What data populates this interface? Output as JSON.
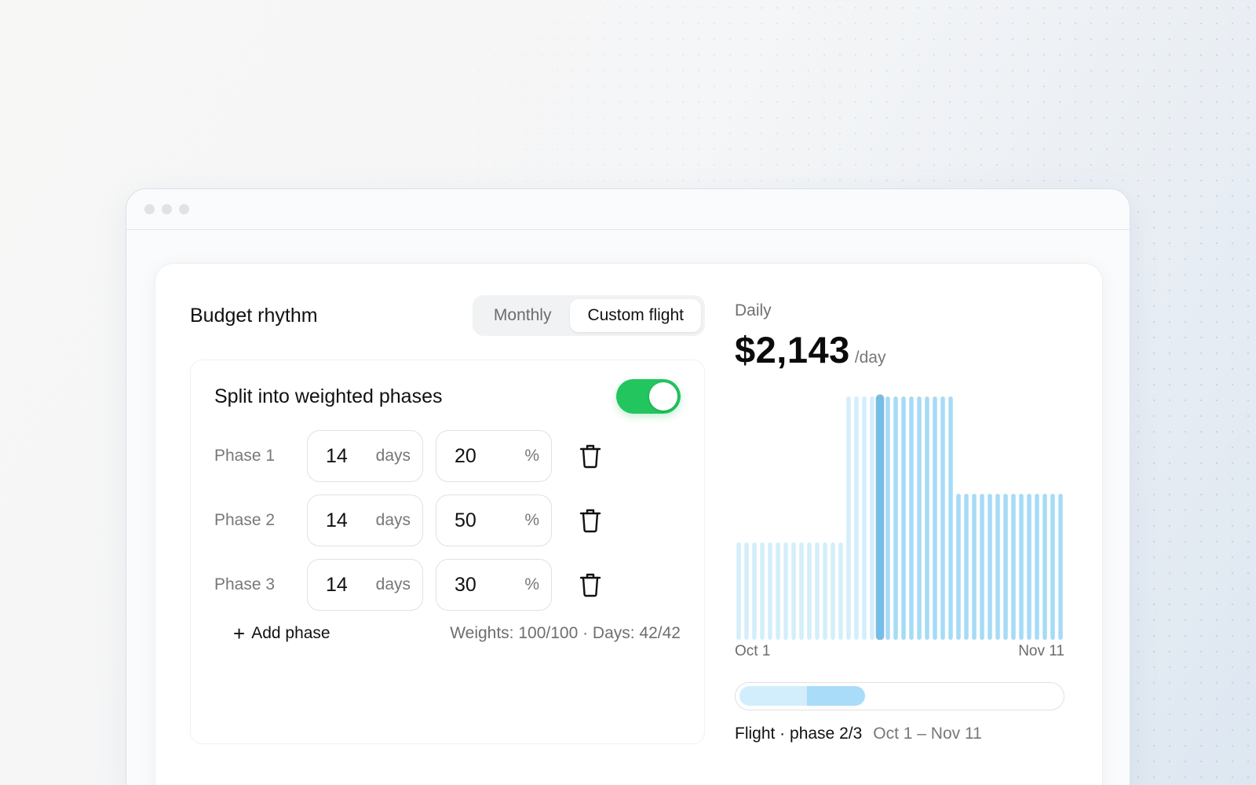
{
  "card": {
    "title": "Budget rhythm",
    "segments": [
      "Monthly",
      "Custom flight"
    ],
    "active_segment": 1
  },
  "split": {
    "label": "Split into weighted phases",
    "enabled": true
  },
  "phases": [
    {
      "label": "Phase 1",
      "days": "14",
      "days_unit": "days",
      "weight": "20",
      "weight_unit": "%"
    },
    {
      "label": "Phase 2",
      "days": "14",
      "days_unit": "days",
      "weight": "50",
      "weight_unit": "%"
    },
    {
      "label": "Phase 3",
      "days": "14",
      "days_unit": "days",
      "weight": "30",
      "weight_unit": "%"
    }
  ],
  "add_phase_label": "Add phase",
  "summary": "Weights: 100/100 · Days: 42/42",
  "daily": {
    "label": "Daily",
    "amount": "$2,143",
    "unit": "/day"
  },
  "chart_data": {
    "type": "bar",
    "x_start_label": "Oct 1",
    "x_end_label": "Nov 11",
    "days": 42,
    "phase_days": [
      14,
      14,
      14
    ],
    "phase_weights": [
      20,
      50,
      30
    ],
    "selected_day": 18,
    "colors": {
      "phase_1": "#d4eefb",
      "phase_2_past": "#d4eefb",
      "phase_2_current": "#a6dbf6",
      "phase_3": "#a6dbf6",
      "selected": "#6cc0ec"
    }
  },
  "timeline": {
    "progress_done_fraction": 0.21,
    "progress_current_fraction": 0.18,
    "phase_text": "Flight · phase 2/3",
    "range_text": "Oct 1 – Nov 11"
  }
}
